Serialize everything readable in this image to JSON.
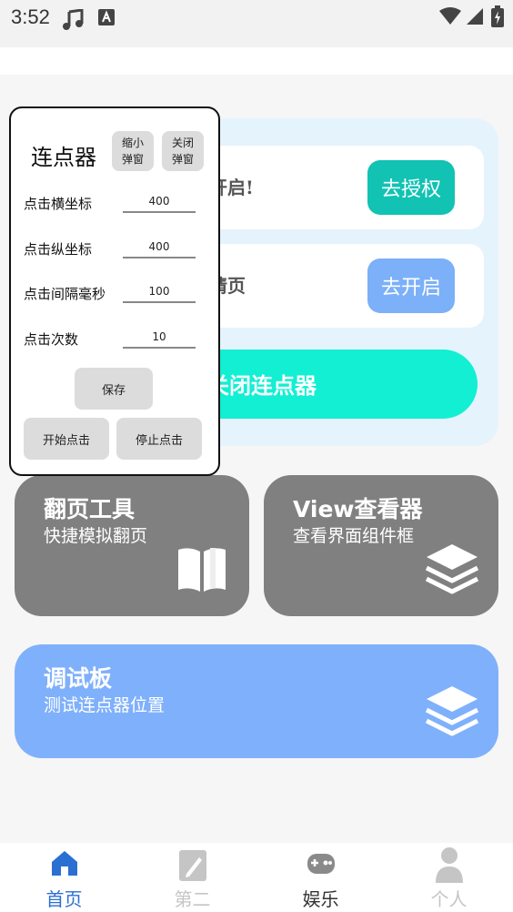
{
  "status": {
    "time": "3:52"
  },
  "panel": {
    "row1_text": "开启!",
    "row1_button": "去授权",
    "row2_text": "请页",
    "row2_button": "去开启",
    "big_button": "关闭连点器"
  },
  "tiles": {
    "page_tool": {
      "title": "翻页工具",
      "subtitle": "快捷模拟翻页",
      "icon": "book-icon"
    },
    "view_viewer": {
      "title": "View查看器",
      "subtitle": "查看界面组件框",
      "icon": "layers-icon"
    },
    "debug": {
      "title": "调试板",
      "subtitle": "测试连点器位置",
      "icon": "layers-icon"
    }
  },
  "float": {
    "title": "连点器",
    "shrink_line1": "缩小",
    "shrink_line2": "弹窗",
    "close_line1": "关闭",
    "close_line2": "弹窗",
    "x_label": "点击横坐标",
    "x_value": "400",
    "y_label": "点击纵坐标",
    "y_value": "400",
    "interval_label": "点击间隔毫秒",
    "interval_value": "100",
    "count_label": "点击次数",
    "count_value": "10",
    "save": "保存",
    "start": "开始点击",
    "stop": "停止点击"
  },
  "nav": {
    "items": [
      {
        "label": "首页",
        "icon": "home-icon",
        "active": true
      },
      {
        "label": "第二",
        "icon": "edit-icon",
        "active": false
      },
      {
        "label": "娱乐",
        "icon": "gamepad-icon",
        "active": false
      },
      {
        "label": "个人",
        "icon": "user-icon",
        "active": false
      }
    ]
  },
  "colors": {
    "teal": "#12c2b3",
    "blue": "#7cb0f8",
    "cyan": "#13efd3",
    "tile_gray": "#808080",
    "tile_blue": "#7fb0fb",
    "nav_active": "#2a6fd2"
  }
}
